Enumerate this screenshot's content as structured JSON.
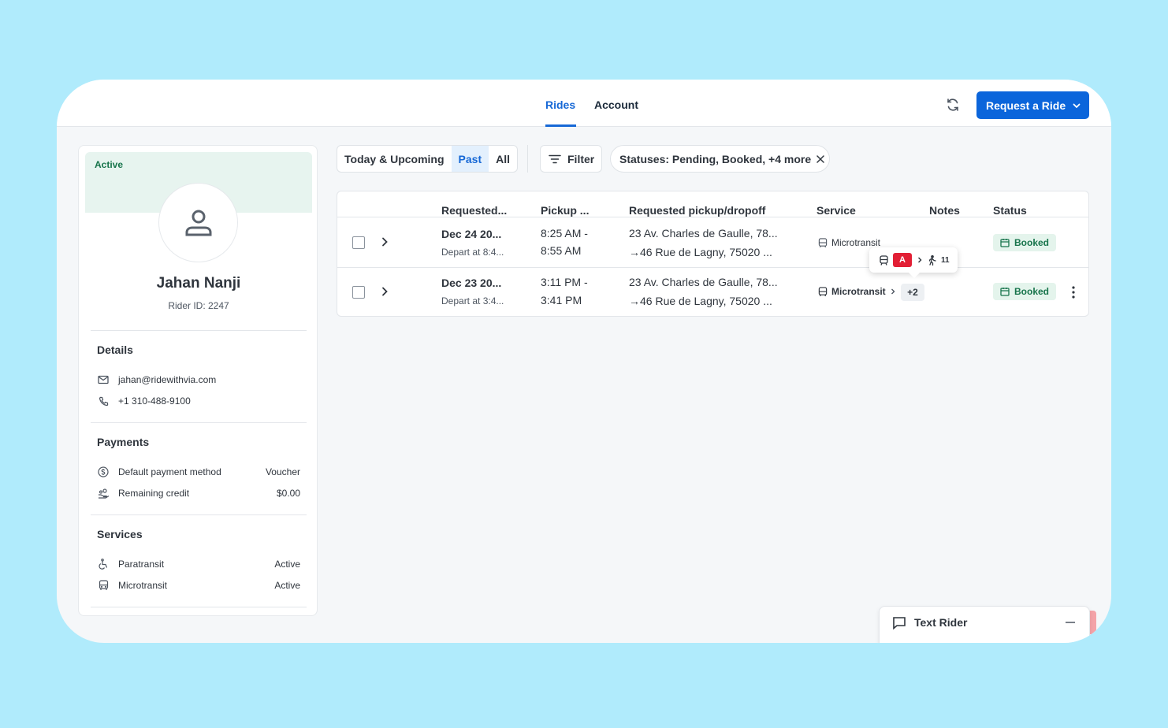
{
  "nav": {
    "tabs": [
      {
        "label": "Rides",
        "active": true
      },
      {
        "label": "Account",
        "active": false
      }
    ],
    "request_button": "Request a Ride"
  },
  "profile": {
    "status": "Active",
    "name": "Jahan Nanji",
    "rider_id": "Rider ID: 2247",
    "details": {
      "title": "Details",
      "email": "jahan@ridewithvia.com",
      "phone": "+1 310-488-9100"
    },
    "payments": {
      "title": "Payments",
      "items": [
        {
          "label": "Default payment method",
          "value": "Voucher",
          "icon": "dollar-circle-icon"
        },
        {
          "label": "Remaining credit",
          "value": "$0.00",
          "icon": "credit-hand-icon"
        }
      ]
    },
    "services": {
      "title": "Services",
      "items": [
        {
          "label": "Paratransit",
          "value": "Active",
          "icon": "wheelchair-icon"
        },
        {
          "label": "Microtransit",
          "value": "Active",
          "icon": "bus-icon"
        }
      ]
    }
  },
  "toolbar": {
    "segments": [
      {
        "label": "Today & Upcoming",
        "selected": false
      },
      {
        "label": "Past",
        "selected": true
      },
      {
        "label": "All",
        "selected": false
      }
    ],
    "filter_label": "Filter",
    "status_chip": "Statuses: Pending, Booked, +4 more"
  },
  "table": {
    "columns": [
      "Requested...",
      "Pickup ...",
      "Requested pickup/dropoff",
      "Service",
      "Notes",
      "Status"
    ],
    "rows": [
      {
        "requested": "Dec 24 20...",
        "depart": "Depart at 8:4...",
        "pickup_start": "8:25 AM -",
        "pickup_end": "8:55 AM",
        "from": "23 Av. Charles de Gaulle, 78...",
        "to": "46 Rue de Lagny, 75020 ...",
        "service": "Microtransit",
        "status": "Booked"
      },
      {
        "requested": "Dec 23 20...",
        "depart": "Depart at 3:4...",
        "pickup_start": "3:11 PM -",
        "pickup_end": "3:41 PM",
        "from": "23 Av. Charles de Gaulle, 78...",
        "to": "46 Rue de Lagny, 75020 ...",
        "service": "Microtransit",
        "extra": "+2",
        "status": "Booked"
      }
    ],
    "tooltip": {
      "route": "A",
      "walk": "11"
    }
  },
  "text_rider": {
    "label": "Text Rider"
  },
  "colors": {
    "primary": "#0b65db",
    "active_green": "#17744b",
    "route_red": "#e21f35",
    "background": "#b0ebfc"
  }
}
